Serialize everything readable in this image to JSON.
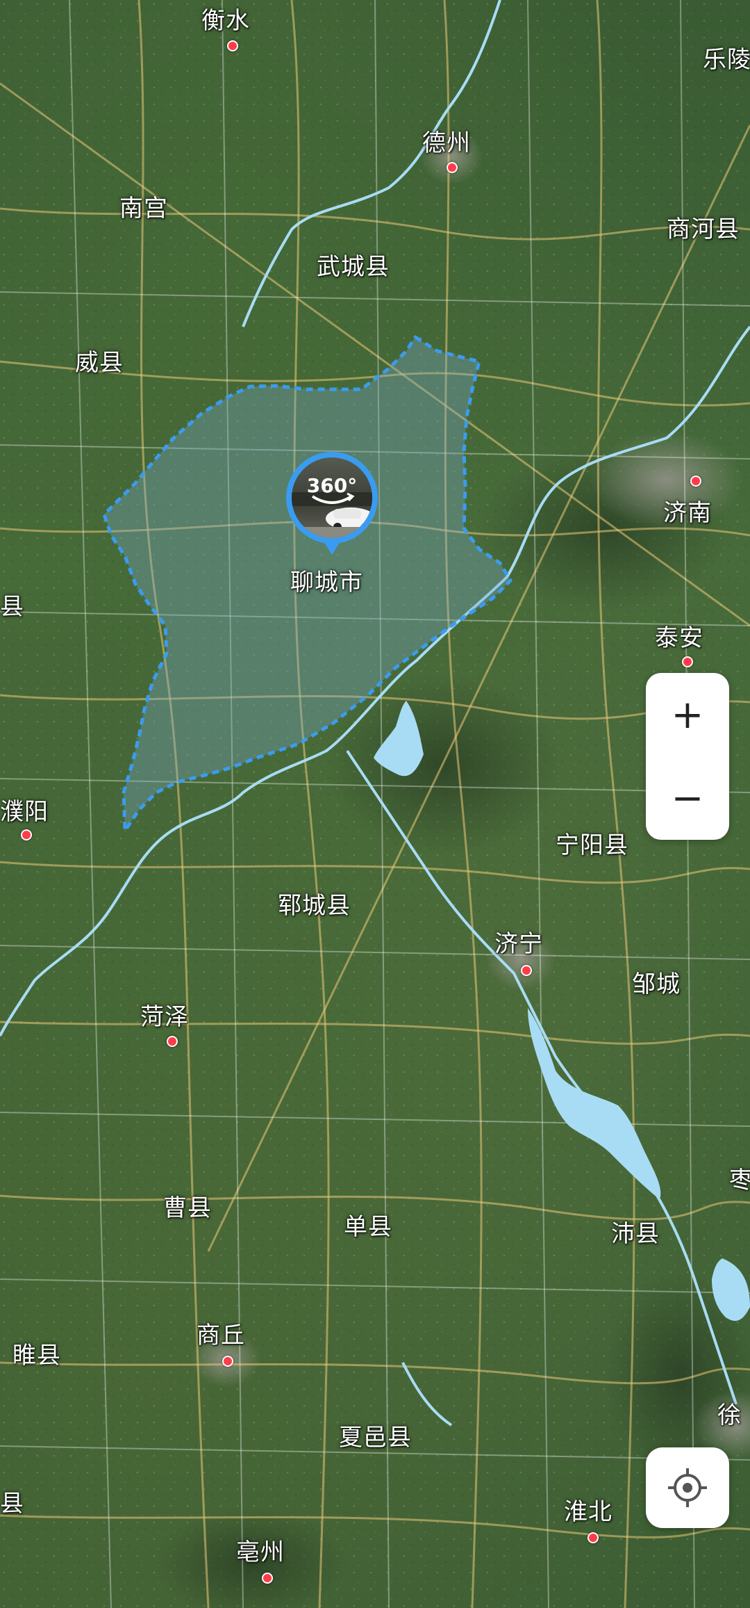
{
  "map": {
    "type": "satellite",
    "region_highlight": {
      "name": "聊城市",
      "border_color": "#3a9cf0",
      "fill_color": "rgba(120,170,200,0.35)"
    },
    "water_color": "#a8dcf5",
    "cities": [
      {
        "id": "hengshui",
        "label": "衡水",
        "has_dot": true
      },
      {
        "id": "dezhou",
        "label": "德州",
        "has_dot": true
      },
      {
        "id": "leling",
        "label": "乐陵",
        "has_dot": false
      },
      {
        "id": "nangong",
        "label": "南宫",
        "has_dot": false
      },
      {
        "id": "shanghe",
        "label": "商河县",
        "has_dot": false
      },
      {
        "id": "wucheng",
        "label": "武城县",
        "has_dot": false
      },
      {
        "id": "weixian",
        "label": "威县",
        "has_dot": false
      },
      {
        "id": "jinan",
        "label": "济南",
        "has_dot": true
      },
      {
        "id": "xian-left",
        "label": "县",
        "has_dot": false
      },
      {
        "id": "taian",
        "label": "泰安",
        "has_dot": true
      },
      {
        "id": "puyang",
        "label": "濮阳",
        "has_dot": true
      },
      {
        "id": "ningyang",
        "label": "宁阳县",
        "has_dot": false
      },
      {
        "id": "yuncheng",
        "label": "郓城县",
        "has_dot": false
      },
      {
        "id": "jining",
        "label": "济宁",
        "has_dot": true
      },
      {
        "id": "zoucheng",
        "label": "邹城",
        "has_dot": false
      },
      {
        "id": "heze",
        "label": "菏泽",
        "has_dot": true
      },
      {
        "id": "zao",
        "label": "枣",
        "has_dot": false
      },
      {
        "id": "caoxian",
        "label": "曹县",
        "has_dot": false
      },
      {
        "id": "shanxian",
        "label": "单县",
        "has_dot": false
      },
      {
        "id": "peixian",
        "label": "沛县",
        "has_dot": false
      },
      {
        "id": "shangqiu",
        "label": "商丘",
        "has_dot": true
      },
      {
        "id": "suixian",
        "label": "睢县",
        "has_dot": false
      },
      {
        "id": "xu",
        "label": "徐",
        "has_dot": false
      },
      {
        "id": "xiayi",
        "label": "夏邑县",
        "has_dot": false
      },
      {
        "id": "xian-bottom-left",
        "label": "县",
        "has_dot": false
      },
      {
        "id": "huaibei",
        "label": "淮北",
        "has_dot": true
      },
      {
        "id": "bozhou",
        "label": "亳州",
        "has_dot": true
      }
    ]
  },
  "panorama_marker": {
    "badge_text": "360°",
    "label": "聊城市",
    "icon": "panorama-360-icon"
  },
  "controls": {
    "zoom_in_label": "+",
    "zoom_out_label": "−",
    "locate_icon": "locate-crosshair-icon"
  }
}
